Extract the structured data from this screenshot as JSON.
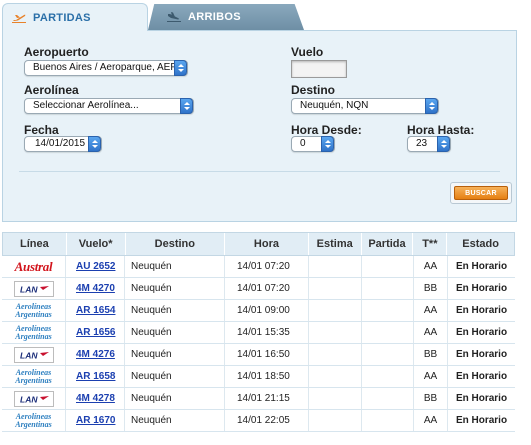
{
  "tabs": [
    {
      "label": "PARTIDAS",
      "icon": "plane-departure-icon",
      "active": true
    },
    {
      "label": "ARRIBOS",
      "icon": "plane-arrival-icon",
      "active": false
    }
  ],
  "form": {
    "aeropuerto": {
      "label": "Aeropuerto",
      "value": "Buenos Aires / Aeroparque, AEP"
    },
    "aerolinea": {
      "label": "Aerolínea",
      "value": "Seleccionar Aerolínea..."
    },
    "fecha": {
      "label": "Fecha",
      "value": "14/01/2015"
    },
    "vuelo": {
      "label": "Vuelo",
      "value": ""
    },
    "destino": {
      "label": "Destino",
      "value": "Neuquén, NQN"
    },
    "hora_desde": {
      "label": "Hora Desde:",
      "value": "0"
    },
    "hora_hasta": {
      "label": "Hora Hasta:",
      "value": "23"
    },
    "buscar_label": "BUSCAR"
  },
  "table": {
    "headers": {
      "linea": "Línea",
      "vuelo": "Vuelo*",
      "destino": "Destino",
      "hora": "Hora",
      "estima": "Estima",
      "partida": "Partida",
      "terminal": "T**",
      "estado": "Estado"
    },
    "rows": [
      {
        "airline": "Austral",
        "logo": "austral",
        "vuelo": "AU 2652",
        "destino": "Neuquén",
        "hora": "14/01 07:20",
        "estima": "",
        "partida": "",
        "terminal": "AA",
        "estado": "En Horario"
      },
      {
        "airline": "LAN",
        "logo": "lan",
        "vuelo": "4M 4270",
        "destino": "Neuquén",
        "hora": "14/01 07:20",
        "estima": "",
        "partida": "",
        "terminal": "BB",
        "estado": "En Horario"
      },
      {
        "airline": "Aerolíneas Argentinas",
        "logo": "ar",
        "vuelo": "AR 1654",
        "destino": "Neuquén",
        "hora": "14/01 09:00",
        "estima": "",
        "partida": "",
        "terminal": "AA",
        "estado": "En Horario"
      },
      {
        "airline": "Aerolíneas Argentinas",
        "logo": "ar",
        "vuelo": "AR 1656",
        "destino": "Neuquén",
        "hora": "14/01 15:35",
        "estima": "",
        "partida": "",
        "terminal": "AA",
        "estado": "En Horario"
      },
      {
        "airline": "LAN",
        "logo": "lan",
        "vuelo": "4M 4276",
        "destino": "Neuquén",
        "hora": "14/01 16:50",
        "estima": "",
        "partida": "",
        "terminal": "BB",
        "estado": "En Horario"
      },
      {
        "airline": "Aerolíneas Argentinas",
        "logo": "ar",
        "vuelo": "AR 1658",
        "destino": "Neuquén",
        "hora": "14/01 18:50",
        "estima": "",
        "partida": "",
        "terminal": "AA",
        "estado": "En Horario"
      },
      {
        "airline": "LAN",
        "logo": "lan",
        "vuelo": "4M 4278",
        "destino": "Neuquén",
        "hora": "14/01 21:15",
        "estima": "",
        "partida": "",
        "terminal": "BB",
        "estado": "En Horario"
      },
      {
        "airline": "Aerolíneas Argentinas",
        "logo": "ar",
        "vuelo": "AR 1670",
        "destino": "Neuquén",
        "hora": "14/01 22:05",
        "estima": "",
        "partida": "",
        "terminal": "AA",
        "estado": "En Horario"
      }
    ]
  },
  "colors": {
    "panel_bg": "#e8f2f8",
    "tab_active_text": "#2a6fa8",
    "tab_inactive_bg": "#7e9cb1",
    "buscar_orange": "#ee9631",
    "link_blue": "#1b3fb0",
    "austral_red": "#d2141c",
    "ar_blue": "#2f80c0",
    "lan_navy": "#1d2f7a"
  }
}
